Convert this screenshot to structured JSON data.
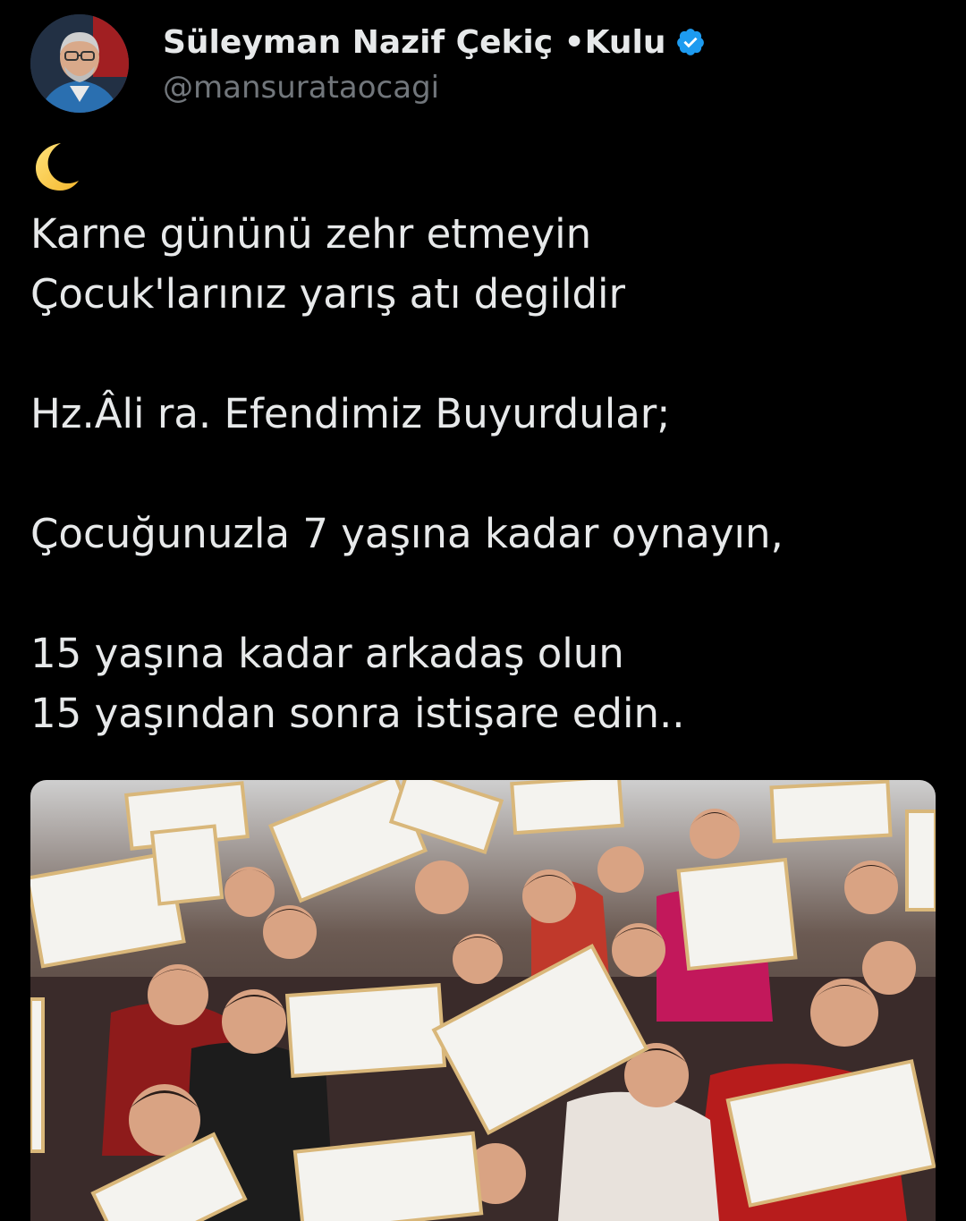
{
  "tweet": {
    "author": {
      "display_name": "Süleyman Nazif Çekiç •Kulu",
      "handle": "@mansurataocagi",
      "verified": true,
      "verified_icon": "verified-badge-icon",
      "verified_color": "#1d9bf0"
    },
    "emoji": "crescent-moon-icon",
    "lines": [
      "Karne gününü zehr etmeyin",
      "Çocuk'larınız yarış atı degildir",
      "",
      "Hz.Âli ra. Efendimiz Buyurdular;",
      "",
      "Çocuğunuzla 7 yaşına kadar oynayın,",
      "",
      "15 yaşına kadar arkadaş olun",
      "15 yaşından sonra istişare edin.."
    ],
    "colors": {
      "background": "#000000",
      "text": "#e7e9ea",
      "secondary_text": "#71767b"
    }
  }
}
